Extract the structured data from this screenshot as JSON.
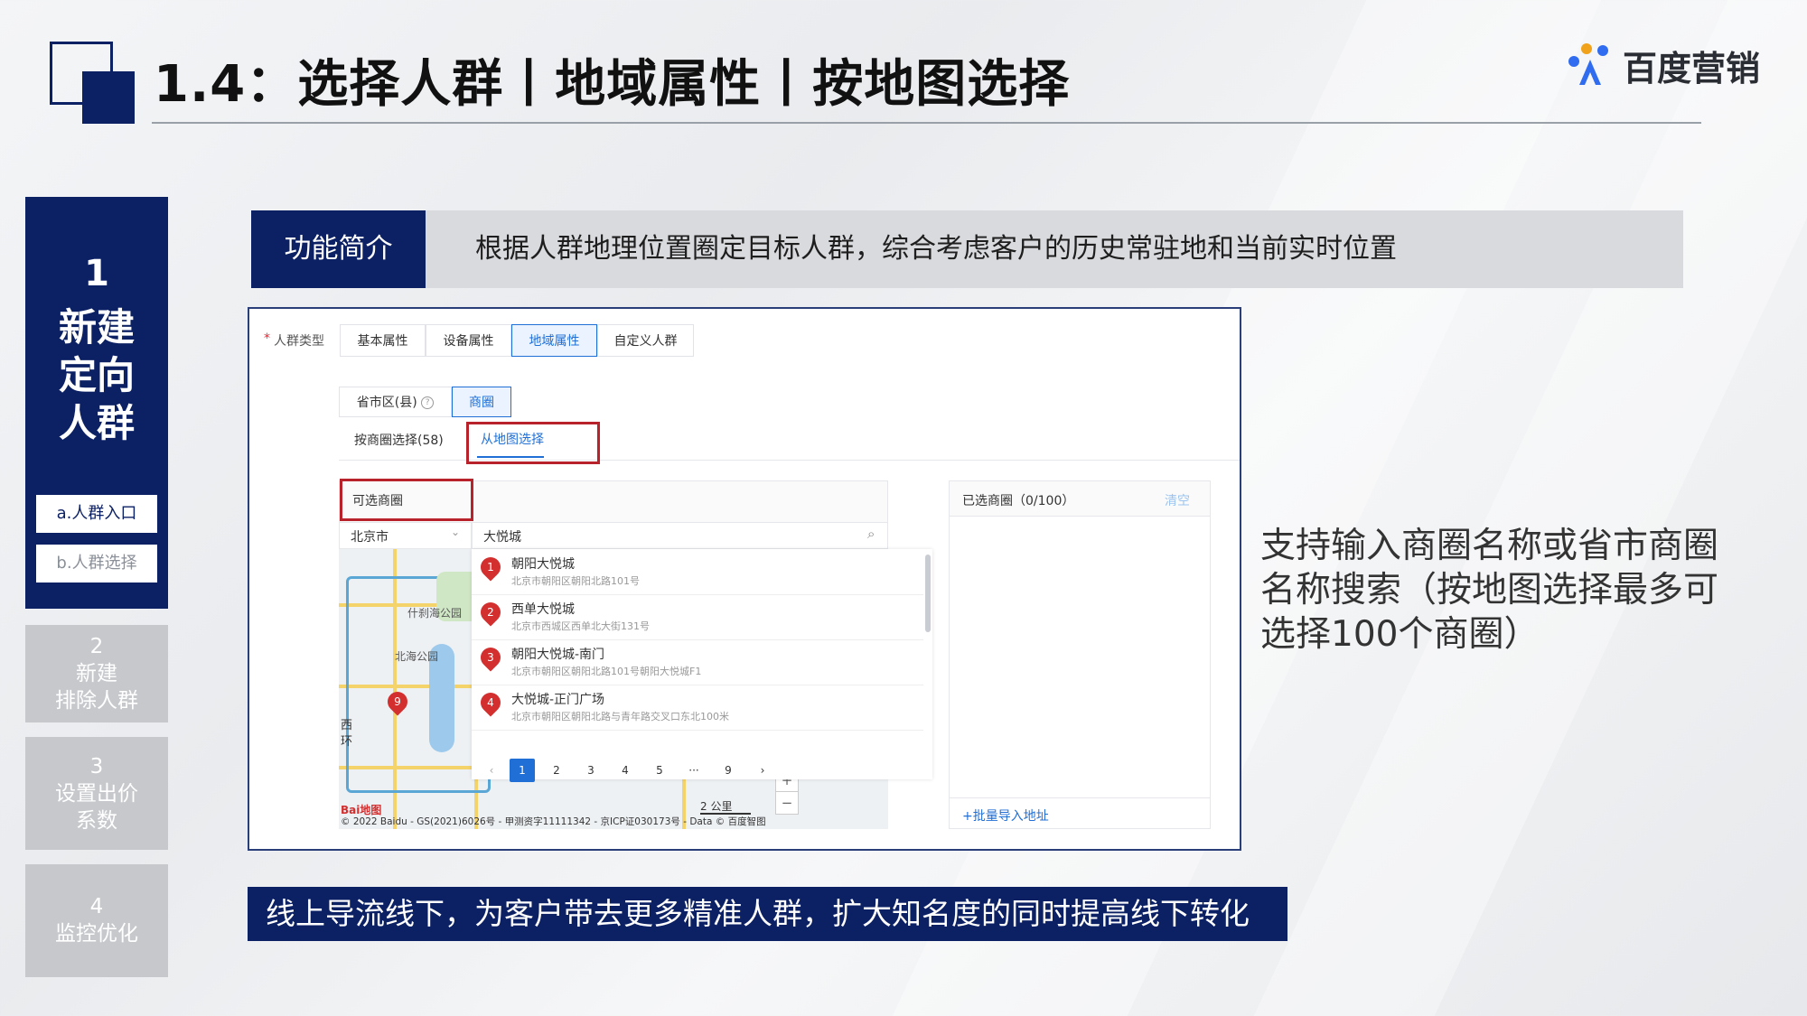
{
  "header": {
    "title": "1.4：选择人群丨地域属性丨按地图选择",
    "brand": "百度营销"
  },
  "nav": {
    "active": {
      "num": "1",
      "label_lines": [
        "新建",
        "定向",
        "人群"
      ]
    },
    "sub_items": [
      "a.人群入口",
      "b.人群选择"
    ],
    "items": [
      {
        "lines": [
          "2",
          "新建",
          "排除人群"
        ]
      },
      {
        "lines": [
          "3",
          "设置出价",
          "系数"
        ]
      },
      {
        "lines": [
          "4",
          "监控优化"
        ]
      }
    ]
  },
  "intro": {
    "label": "功能简介",
    "text": "根据人群地理位置圈定目标人群，综合考虑客户的历史常驻地和当前实时位置"
  },
  "panel": {
    "crowd_type_label": "人群类型",
    "tabs": [
      "基本属性",
      "设备属性",
      "地域属性",
      "自定义人群"
    ],
    "selected_tab": "地域属性",
    "subtabs": [
      "省市区(县)",
      "商圈"
    ],
    "selected_subtab": "商圈",
    "mode_tabs": [
      "按商圈选择(58)",
      "从地图选择"
    ],
    "selected_mode": "从地图选择",
    "available_header": "可选商圈",
    "city": "北京市",
    "search_value": "大悦城",
    "results": [
      {
        "num": "1",
        "name": "朝阳大悦城",
        "addr": "北京市朝阳区朝阳北路101号"
      },
      {
        "num": "2",
        "name": "西单大悦城",
        "addr": "北京市西城区西单北大街131号"
      },
      {
        "num": "3",
        "name": "朝阳大悦城-南门",
        "addr": "北京市朝阳区朝阳北路101号朝阳大悦城F1"
      },
      {
        "num": "4",
        "name": "大悦城-正门广场",
        "addr": "北京市朝阳区朝阳北路与青年路交叉口东北100米"
      }
    ],
    "pagination": [
      "‹",
      "1",
      "2",
      "3",
      "4",
      "5",
      "···",
      "9",
      "›"
    ],
    "current_page": "1",
    "map_labels": [
      "什刹海公园",
      "北海公园",
      "西",
      "环"
    ],
    "map_pin": "9",
    "scale": "2 公里",
    "zoom_in": "+",
    "zoom_out": "−",
    "copyright": "© 2022 Baidu - GS(2021)6026号 - 甲测资字11111342 - 京ICP证030173号 - Data © 百度智图",
    "map_logo": "Bai地图",
    "selected_header": "已选商圈（0/100）",
    "clear": "清空",
    "bulk_import": "+批量导入地址"
  },
  "side_note": "支持输入商圈名称或省市商圈名称搜索（按地图选择最多可选择100个商圈）",
  "banner": "线上导流线下，为客户带去更多精准人群，扩大知名度的同时提高线下转化",
  "colors": {
    "navy": "#0c2064",
    "accent_blue": "#1f6fd6",
    "highlight_red": "#b8222a",
    "nav_gray": "#c6c8cc"
  }
}
